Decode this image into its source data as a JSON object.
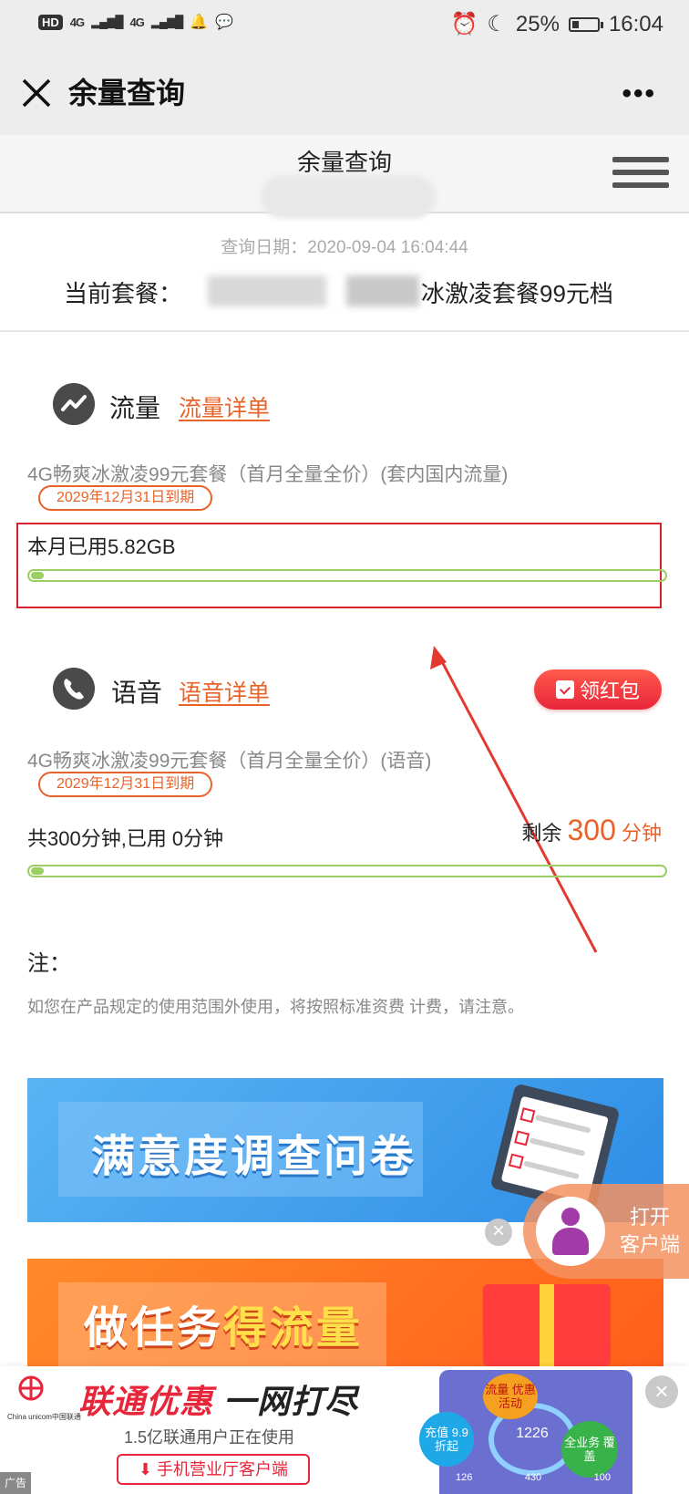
{
  "status_bar": {
    "hd": "HD",
    "signal1": "4G",
    "signal2": "4G",
    "battery": "25%",
    "battery_level": 0.25,
    "time": "16:04"
  },
  "nav": {
    "title": "余量查询",
    "more": "•••"
  },
  "header": {
    "title": "余量查询",
    "query_date": "查询日期：2020-09-04 16:04:44",
    "plan_label": "当前套餐：",
    "plan_name": "冰激凌套餐99元档"
  },
  "data_section": {
    "title": "流量",
    "detail_link": "流量详单",
    "package": "4G畅爽冰激凌99元套餐（首月全量全价）(套内国内流量)",
    "expiry": "2029年12月31日到期",
    "used_text": "本月已用5.82GB",
    "progress": 0.02
  },
  "voice_section": {
    "title": "语音",
    "detail_link": "语音详单",
    "red_packet": "领红包",
    "package": "4G畅爽冰激凌99元套餐（首月全量全价）(语音)",
    "expiry": "2029年12月31日到期",
    "used_text": "共300分钟,已用 0分钟",
    "remain_label": "剩余",
    "remain_value": "300",
    "remain_unit": "分钟",
    "progress": 0.02
  },
  "note": {
    "heading": "注：",
    "text": "如您在产品规定的使用范围外使用，将按照标准资费 计费，请注意。"
  },
  "banners": {
    "survey": "满意度调查问卷",
    "task_prefix": "做任务",
    "task_highlight": "得流量"
  },
  "floating_client": {
    "line1": "打开",
    "line2": "客户端"
  },
  "bottom_ad": {
    "logo_sub": "China unicom中国联通",
    "title_red": "联通优惠",
    "title_black": "一网打尽",
    "subtitle": "1.5亿联通用户正在使用",
    "button": "手机营业厅客户端",
    "bubble_recharge": "充值 9.9折起",
    "bubble_promo": "流量 优惠活动",
    "bubble_all": "全业务 覆盖",
    "center_num": "1226",
    "row": [
      "126",
      "430",
      "100"
    ],
    "tag": "广告"
  },
  "colors": {
    "accent": "#e8632a",
    "highlight_box": "#d9232a",
    "progress": "#9bcf63"
  }
}
